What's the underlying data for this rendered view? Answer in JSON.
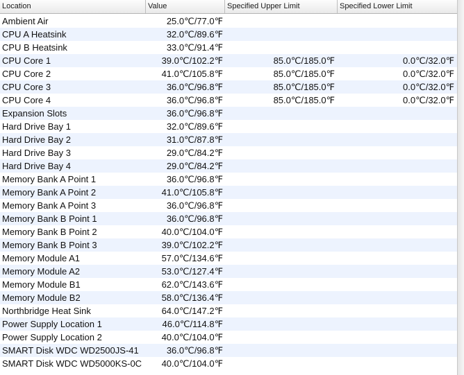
{
  "table": {
    "columns": [
      "Location",
      "Value",
      "Specified Upper Limit",
      "Specified Lower Limit"
    ],
    "rows": [
      {
        "location": "Ambient Air",
        "value": "25.0℃/77.0℉",
        "upper": "",
        "lower": ""
      },
      {
        "location": "CPU A Heatsink",
        "value": "32.0℃/89.6℉",
        "upper": "",
        "lower": ""
      },
      {
        "location": "CPU B Heatsink",
        "value": "33.0℃/91.4℉",
        "upper": "",
        "lower": ""
      },
      {
        "location": "CPU Core 1",
        "value": "39.0℃/102.2℉",
        "upper": "85.0℃/185.0℉",
        "lower": "0.0℃/32.0℉"
      },
      {
        "location": "CPU Core 2",
        "value": "41.0℃/105.8℉",
        "upper": "85.0℃/185.0℉",
        "lower": "0.0℃/32.0℉"
      },
      {
        "location": "CPU Core 3",
        "value": "36.0℃/96.8℉",
        "upper": "85.0℃/185.0℉",
        "lower": "0.0℃/32.0℉"
      },
      {
        "location": "CPU Core 4",
        "value": "36.0℃/96.8℉",
        "upper": "85.0℃/185.0℉",
        "lower": "0.0℃/32.0℉"
      },
      {
        "location": "Expansion Slots",
        "value": "36.0℃/96.8℉",
        "upper": "",
        "lower": ""
      },
      {
        "location": "Hard Drive Bay 1",
        "value": "32.0℃/89.6℉",
        "upper": "",
        "lower": ""
      },
      {
        "location": "Hard Drive Bay 2",
        "value": "31.0℃/87.8℉",
        "upper": "",
        "lower": ""
      },
      {
        "location": "Hard Drive Bay 3",
        "value": "29.0℃/84.2℉",
        "upper": "",
        "lower": ""
      },
      {
        "location": "Hard Drive Bay 4",
        "value": "29.0℃/84.2℉",
        "upper": "",
        "lower": ""
      },
      {
        "location": "Memory Bank A Point 1",
        "value": "36.0℃/96.8℉",
        "upper": "",
        "lower": ""
      },
      {
        "location": "Memory Bank A Point 2",
        "value": "41.0℃/105.8℉",
        "upper": "",
        "lower": ""
      },
      {
        "location": "Memory Bank A Point 3",
        "value": "36.0℃/96.8℉",
        "upper": "",
        "lower": ""
      },
      {
        "location": "Memory Bank B Point 1",
        "value": "36.0℃/96.8℉",
        "upper": "",
        "lower": ""
      },
      {
        "location": "Memory Bank B Point 2",
        "value": "40.0℃/104.0℉",
        "upper": "",
        "lower": ""
      },
      {
        "location": "Memory Bank B Point 3",
        "value": "39.0℃/102.2℉",
        "upper": "",
        "lower": ""
      },
      {
        "location": "Memory Module A1",
        "value": "57.0℃/134.6℉",
        "upper": "",
        "lower": ""
      },
      {
        "location": "Memory Module A2",
        "value": "53.0℃/127.4℉",
        "upper": "",
        "lower": ""
      },
      {
        "location": "Memory Module B1",
        "value": "62.0℃/143.6℉",
        "upper": "",
        "lower": ""
      },
      {
        "location": "Memory Module B2",
        "value": "58.0℃/136.4℉",
        "upper": "",
        "lower": ""
      },
      {
        "location": "Northbridge Heat Sink",
        "value": "64.0℃/147.2℉",
        "upper": "",
        "lower": ""
      },
      {
        "location": "Power Supply Location 1",
        "value": "46.0℃/114.8℉",
        "upper": "",
        "lower": ""
      },
      {
        "location": "Power Supply Location 2",
        "value": "40.0℃/104.0℉",
        "upper": "",
        "lower": ""
      },
      {
        "location": "SMART Disk WDC WD2500JS-41",
        "value": "36.0℃/96.8℉",
        "upper": "",
        "lower": ""
      },
      {
        "location": "SMART Disk WDC WD5000KS-0C",
        "value": "40.0℃/104.0℉",
        "upper": "",
        "lower": ""
      }
    ]
  },
  "colors": {
    "row_alternate": "#edf3fe",
    "header_border": "#b4b4b4"
  }
}
